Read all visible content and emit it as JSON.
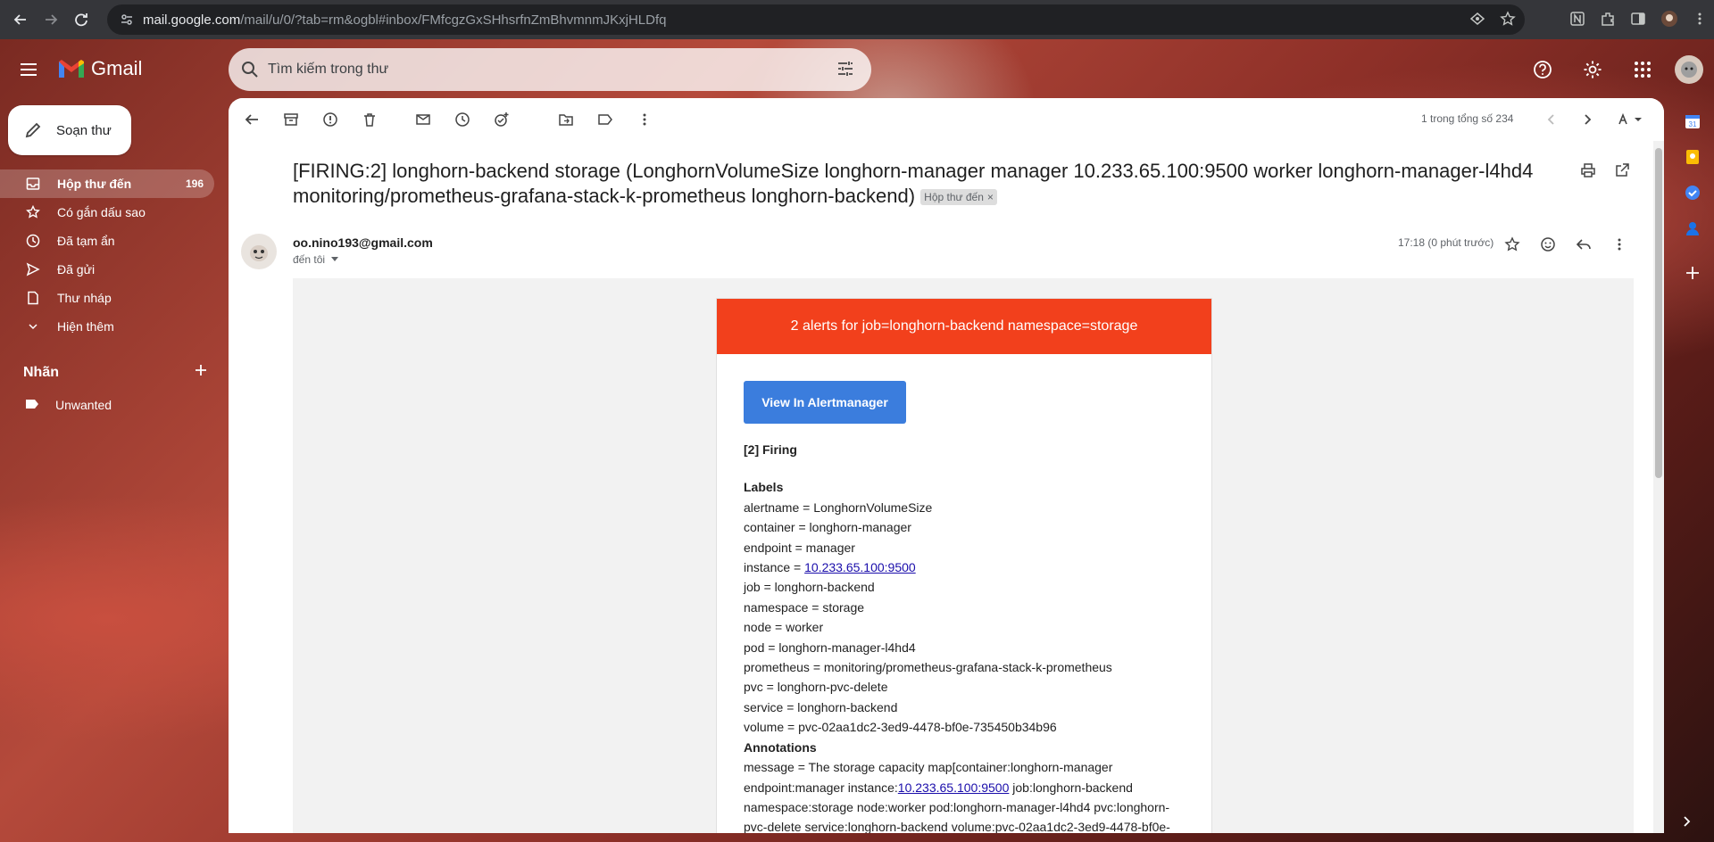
{
  "browser": {
    "url_host": "mail.google.com",
    "url_path": "/mail/u/0/?tab=rm&ogbl#inbox/FMfcgzGxSHhsrfnZmBhvmnmJKxjHLDfq"
  },
  "app": {
    "name": "Gmail"
  },
  "search": {
    "placeholder": "Tìm kiếm trong thư"
  },
  "compose": {
    "label": "Soạn thư"
  },
  "sidebar": {
    "items": [
      {
        "label": "Hộp thư đến",
        "count": "196",
        "icon": "inbox-icon"
      },
      {
        "label": "Có gắn dấu sao",
        "icon": "star-icon"
      },
      {
        "label": "Đã tạm ẩn",
        "icon": "clock-icon"
      },
      {
        "label": "Đã gửi",
        "icon": "send-icon"
      },
      {
        "label": "Thư nháp",
        "icon": "draft-icon"
      },
      {
        "label": "Hiện thêm",
        "icon": "chevron-down-icon"
      }
    ],
    "labels_title": "Nhãn",
    "labels": [
      {
        "label": "Unwanted"
      }
    ]
  },
  "toolbar": {
    "pager": "1 trong tổng số 234"
  },
  "message": {
    "subject": "[FIRING:2] longhorn-backend storage (LonghornVolumeSize longhorn-manager manager 10.233.65.100:9500 worker longhorn-manager-l4hd4 monitoring/prometheus-grafana-stack-k-prometheus longhorn-backend)",
    "badge": "Hộp thư đến",
    "sender": "oo.nino193@gmail.com",
    "to": "đến tôi",
    "time": "17:18 (0 phút trước)"
  },
  "email": {
    "header": "2 alerts for job=longhorn-backend namespace=storage",
    "button": "View In Alertmanager",
    "firing": "[2] Firing",
    "labels_title": "Labels",
    "labels": [
      {
        "text": "alertname = LonghornVolumeSize"
      },
      {
        "text": "container = longhorn-manager"
      },
      {
        "text": "endpoint = manager"
      },
      {
        "prefix": "instance = ",
        "link": "10.233.65.100:9500"
      },
      {
        "text": "job = longhorn-backend"
      },
      {
        "text": "namespace = storage"
      },
      {
        "text": "node = worker"
      },
      {
        "text": "pod = longhorn-manager-l4hd4"
      },
      {
        "text": "prometheus = monitoring/prometheus-grafana-stack-k-prometheus"
      },
      {
        "text": "pvc = longhorn-pvc-delete"
      },
      {
        "text": "service = longhorn-backend"
      },
      {
        "text": "volume = pvc-02aa1dc2-3ed9-4478-bf0e-735450b34b96"
      }
    ],
    "annotations_title": "Annotations",
    "annotation_line1": "message = The storage capacity map[container:longhorn-manager",
    "annotation_line2_prefix": "endpoint:manager instance:",
    "annotation_line2_link": "10.233.65.100:9500",
    "annotation_line2_suffix": " job:longhorn-backend",
    "annotation_line3": "namespace:storage node:worker pod:longhorn-manager-l4hd4 pvc:longhorn-",
    "annotation_line4": "pvc-delete service:longhorn-backend volume:pvc-02aa1dc2-3ed9-4478-bf0e-"
  },
  "colors": {
    "alert_red": "#f2401c",
    "button_blue": "#3b7ddd",
    "link": "#1a0dab"
  }
}
